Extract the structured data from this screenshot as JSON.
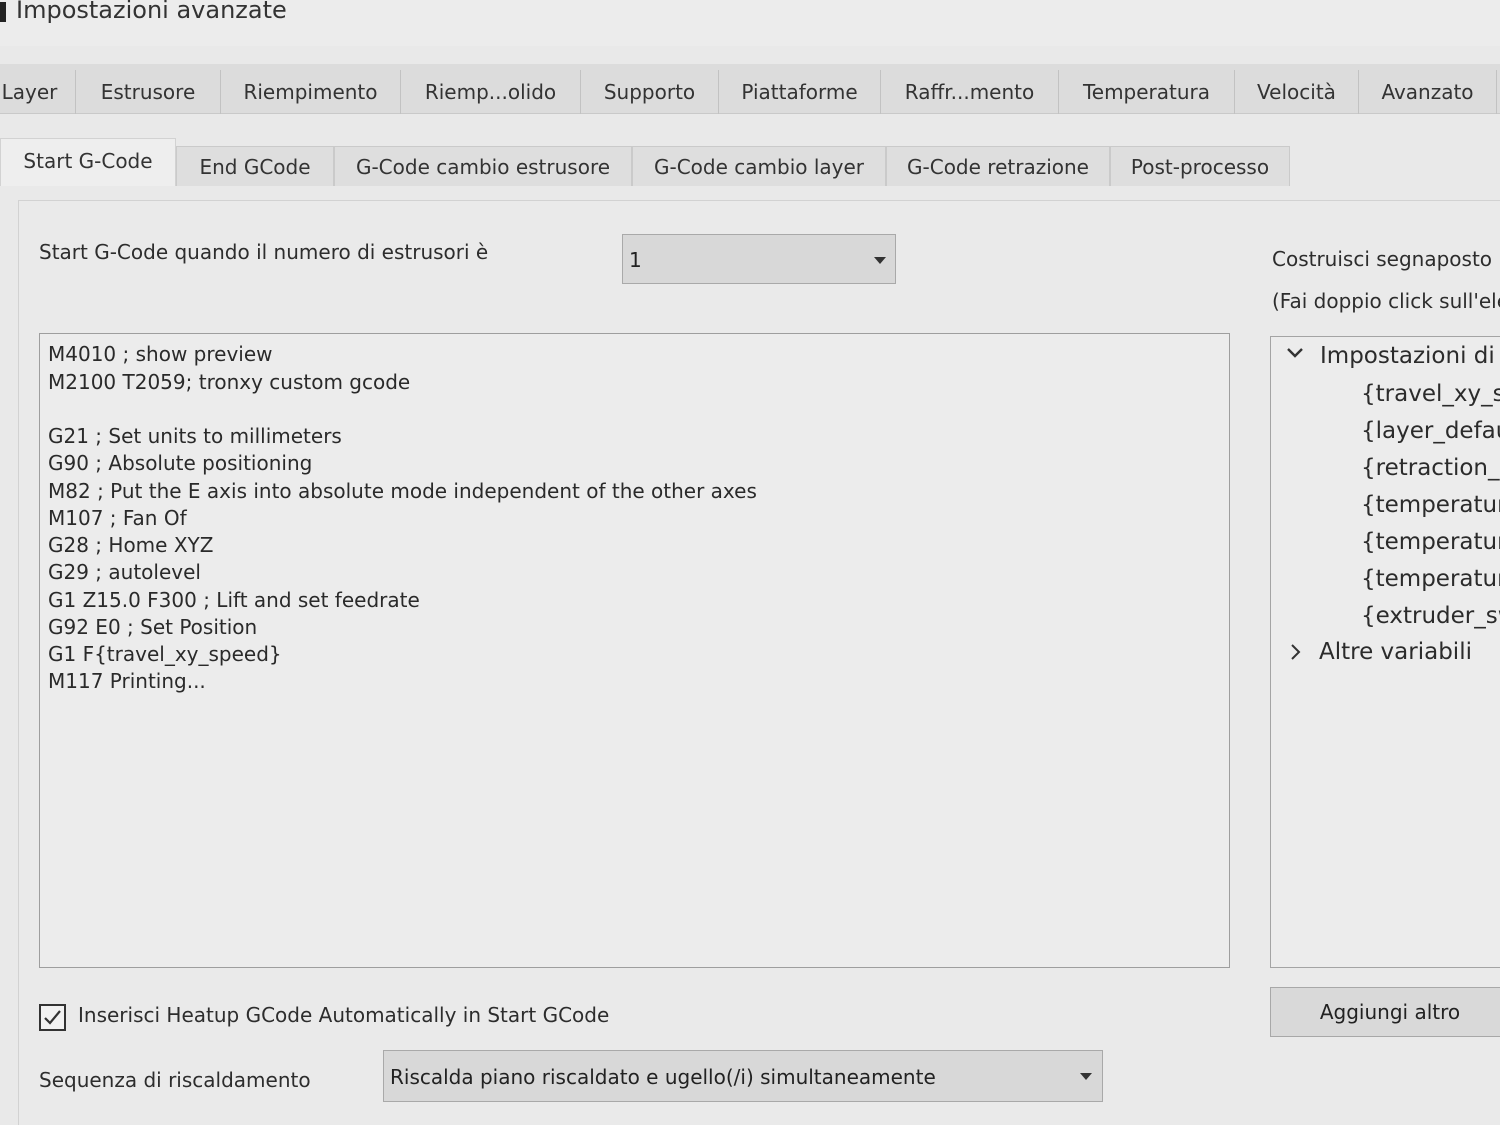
{
  "window": {
    "title": "Impostazioni avanzate"
  },
  "main_tabs": [
    {
      "label": "Layer"
    },
    {
      "label": "Estrusore"
    },
    {
      "label": "Riempimento"
    },
    {
      "label": "Riemp...olido"
    },
    {
      "label": "Supporto"
    },
    {
      "label": "Piattaforme"
    },
    {
      "label": "Raffr...mento"
    },
    {
      "label": "Temperatura"
    },
    {
      "label": "Velocità"
    },
    {
      "label": "Avanzato"
    }
  ],
  "sub_tabs": [
    {
      "label": "Start G-Code",
      "active": true
    },
    {
      "label": "End GCode"
    },
    {
      "label": "G-Code cambio estrusore"
    },
    {
      "label": "G-Code cambio layer"
    },
    {
      "label": "G-Code retrazione"
    },
    {
      "label": "Post-processo"
    }
  ],
  "extruder_select": {
    "label": "Start G-Code quando il numero di estrusori è",
    "value": "1"
  },
  "gcode_lines": [
    "M4010 ; show preview",
    "M2100 T2059; tronxy custom gcode",
    "",
    "G21 ; Set units to millimeters",
    "G90 ; Absolute positioning",
    "M82 ; Put the E axis into absolute mode independent of the other axes",
    "M107 ; Fan Of",
    "G28 ; Home XYZ",
    "G29 ; autolevel",
    "G1 Z15.0 F300 ; Lift and set feedrate",
    "G92 E0 ; Set Position",
    "G1 F{travel_xy_speed}",
    "M117 Printing..."
  ],
  "placeholders": {
    "title": "Costruisci segnaposto",
    "hint": "(Fai doppio click sull'ele",
    "group_expanded": "Impostazioni di",
    "items": [
      "{travel_xy_sp",
      "{layer_defaul",
      "{retraction_s",
      "{temperature",
      "{temperature",
      "{temperature",
      "{extruder_sw"
    ],
    "group_collapsed": "Altre variabili",
    "add_button": "Aggiungi altro"
  },
  "heatup_checkbox": {
    "label": "Inserisci Heatup GCode Automatically in Start GCode",
    "checked": true
  },
  "heating_sequence": {
    "label": "Sequenza di riscaldamento",
    "value": "Riscalda piano riscaldato e ugello(/i) simultaneamente"
  }
}
